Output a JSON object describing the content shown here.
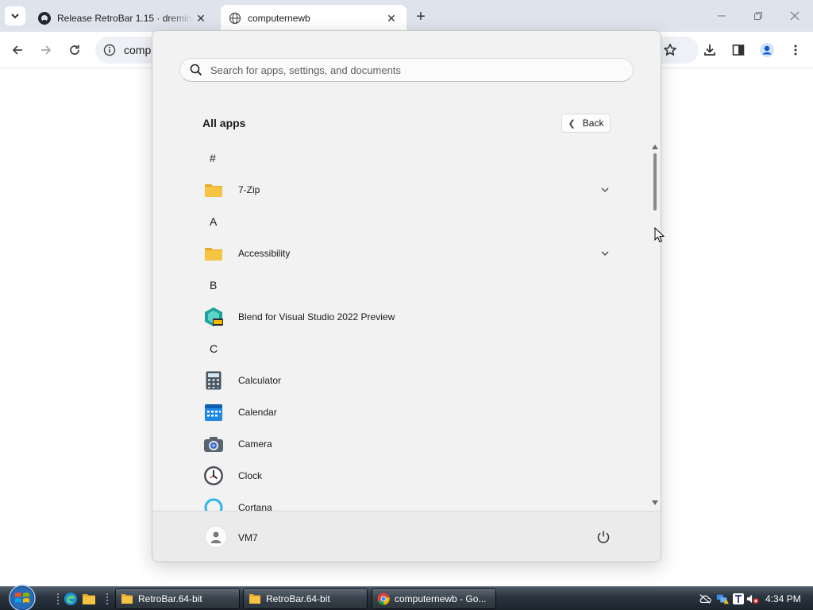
{
  "browser": {
    "tabs": [
      {
        "title": "Release RetroBar 1.15 · dremin/",
        "close": "✕",
        "state": "inactive",
        "icon": "github-icon"
      },
      {
        "title": "computernewb",
        "close": "✕",
        "state": "active",
        "icon": "globe-icon"
      }
    ],
    "new_tab_label": "+",
    "omnibox_text": "comp"
  },
  "start_menu": {
    "search_placeholder": "Search for apps, settings, and documents",
    "section_title": "All apps",
    "back_label": "Back",
    "rows": [
      {
        "kind": "letter",
        "text": "#"
      },
      {
        "kind": "app",
        "name": "7-Zip",
        "icon": "folder-icon",
        "expandable": true
      },
      {
        "kind": "letter",
        "text": "A"
      },
      {
        "kind": "app",
        "name": "Accessibility",
        "icon": "folder-icon",
        "expandable": true
      },
      {
        "kind": "letter",
        "text": "B"
      },
      {
        "kind": "app",
        "name": "Blend for Visual Studio 2022 Preview",
        "icon": "blend-icon",
        "expandable": false
      },
      {
        "kind": "letter",
        "text": "C"
      },
      {
        "kind": "app",
        "name": "Calculator",
        "icon": "calculator-icon",
        "expandable": false
      },
      {
        "kind": "app",
        "name": "Calendar",
        "icon": "calendar-icon",
        "expandable": false
      },
      {
        "kind": "app",
        "name": "Camera",
        "icon": "camera-icon",
        "expandable": false
      },
      {
        "kind": "app",
        "name": "Clock",
        "icon": "clock-icon",
        "expandable": false
      },
      {
        "kind": "app",
        "name": "Cortana",
        "icon": "cortana-icon",
        "expandable": false
      }
    ],
    "user_name": "VM7"
  },
  "taskbar": {
    "buttons": [
      {
        "label": "RetroBar.64-bit",
        "icon": "folder-icon",
        "state": "normal"
      },
      {
        "label": "RetroBar.64-bit",
        "icon": "folder-icon",
        "state": "normal"
      },
      {
        "label": "computernewb - Go...",
        "icon": "chrome-icon",
        "state": "normal"
      }
    ],
    "clock": "4:34 PM"
  },
  "colors": {
    "accent": "#0067c0",
    "folder": "#f6c342",
    "taskbar": "#2b3540"
  }
}
